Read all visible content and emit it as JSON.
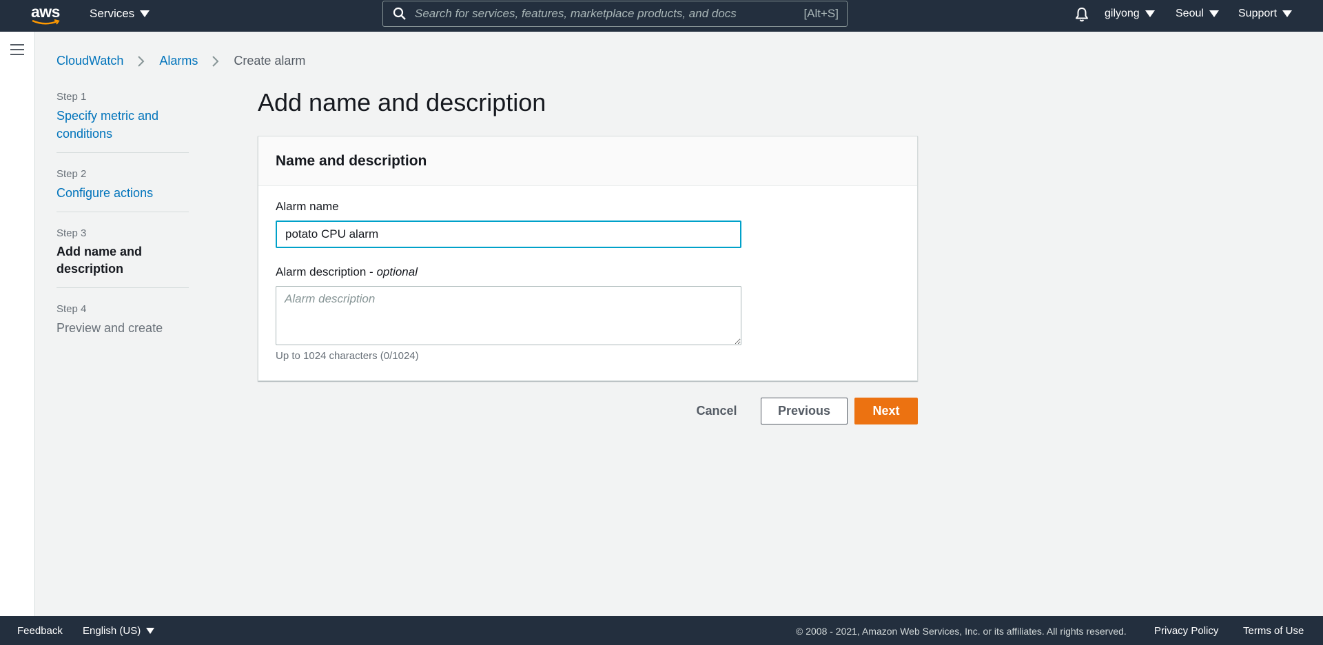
{
  "topnav": {
    "logo_text": "aws",
    "services_label": "Services",
    "search_placeholder": "Search for services, features, marketplace products, and docs",
    "search_shortcut": "[Alt+S]",
    "user": "gilyong",
    "region": "Seoul",
    "support": "Support"
  },
  "breadcrumb": {
    "items": [
      "CloudWatch",
      "Alarms"
    ],
    "current": "Create alarm"
  },
  "steps": [
    {
      "num": "Step 1",
      "label": "Specify metric and conditions"
    },
    {
      "num": "Step 2",
      "label": "Configure actions"
    },
    {
      "num": "Step 3",
      "label": "Add name and description"
    },
    {
      "num": "Step 4",
      "label": "Preview and create"
    }
  ],
  "main": {
    "title": "Add name and description",
    "panel_title": "Name and description",
    "alarm_name_label": "Alarm name",
    "alarm_name_value": "potato CPU alarm",
    "alarm_desc_label": "Alarm description",
    "alarm_desc_optional": "optional",
    "alarm_desc_placeholder": "Alarm description",
    "hint": "Up to 1024 characters (0/1024)"
  },
  "buttons": {
    "cancel": "Cancel",
    "previous": "Previous",
    "next": "Next"
  },
  "footer": {
    "feedback": "Feedback",
    "language": "English (US)",
    "copyright": "© 2008 - 2021, Amazon Web Services, Inc. or its affiliates. All rights reserved.",
    "privacy": "Privacy Policy",
    "terms": "Terms of Use"
  },
  "colors": {
    "nav_bg": "#232f3e",
    "link": "#0073bb",
    "primary_button": "#ec7211",
    "focus_border": "#00a1c9"
  }
}
